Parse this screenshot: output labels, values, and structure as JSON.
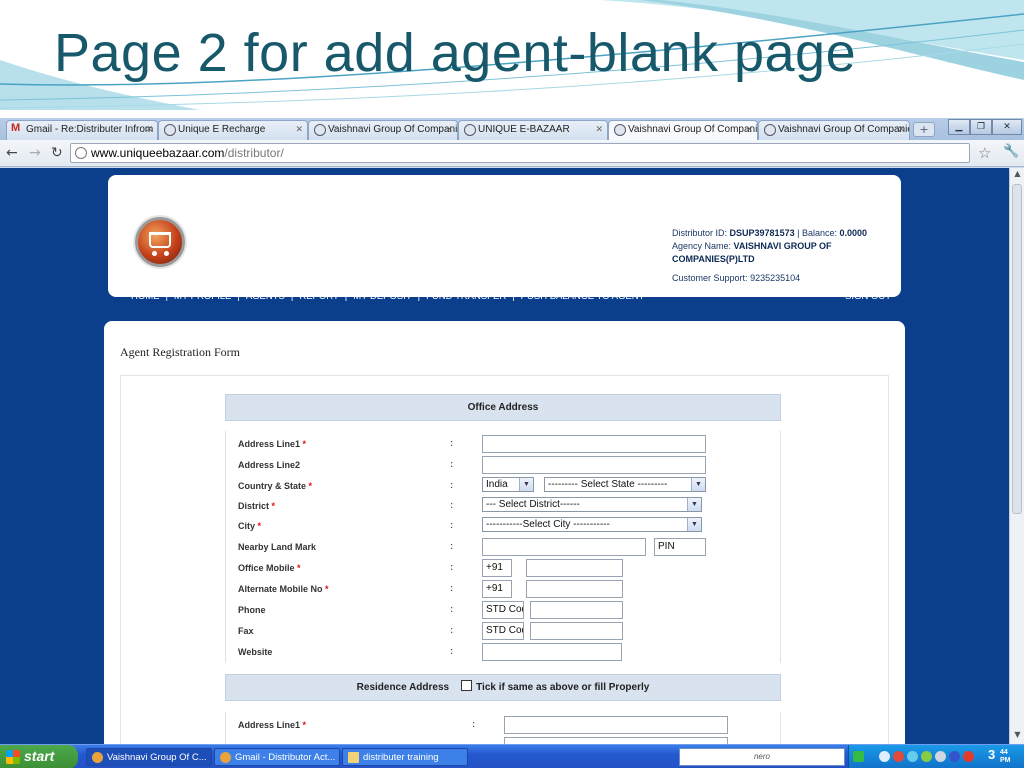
{
  "slide": {
    "title": "Page 2 for add agent-blank page"
  },
  "browser": {
    "tabs": [
      {
        "label": "Gmail - Re:Distributer Infrom"
      },
      {
        "label": "Unique E Recharge"
      },
      {
        "label": "Vaishnavi Group Of Companie"
      },
      {
        "label": "UNIQUE E-BAZAAR"
      },
      {
        "label": "Vaishnavi Group Of Companie"
      },
      {
        "label": "Vaishnavi Group Of Companie"
      }
    ],
    "address": {
      "host": "www.uniqueebazaar.com",
      "path": "/distributor/"
    }
  },
  "site": {
    "account": {
      "distributor_label": "Distributor ID:",
      "distributor_id": "DSUP39781573",
      "sep": "|",
      "balance_label": "Balance:",
      "balance": "0.0000",
      "agency_label": "Agency Name:",
      "agency_name": "VAISHNAVI GROUP OF COMPANIES(P)LTD",
      "support_label": "Customer Support:",
      "support_number": "9235235104"
    },
    "menu": {
      "items": [
        "HOME",
        "MY PROFILE",
        "AGENTS",
        "REPORT",
        "MY DEPOSIT",
        "FUND TRANSFER",
        "PUSH BALANCE TO AGENT"
      ],
      "separator": "|",
      "signout": "SIGN OUT"
    }
  },
  "form": {
    "title": "Agent Registration Form",
    "office_heading": "Office Address",
    "colon": ":",
    "required_mark": "*",
    "fields": {
      "address1": "Address Line1",
      "address2": "Address Line2",
      "country_state": "Country & State",
      "district": "District",
      "city": "City",
      "landmark": "Nearby Land Mark",
      "office_mobile": "Office Mobile",
      "alt_mobile": "Alternate Mobile No",
      "phone": "Phone",
      "fax": "Fax",
      "website": "Website"
    },
    "values": {
      "country": "India",
      "state": "--------- Select State ---------",
      "district": "--- Select District------",
      "city": "-----------Select City -----------",
      "pin_placeholder": "PIN",
      "mobile_prefix": "+91",
      "std_placeholder": "STD Code"
    },
    "residence": {
      "heading": "Residence Address",
      "checkbox_label": "Tick if same as above or fill Properly",
      "address1": "Address Line1"
    }
  },
  "taskbar": {
    "start": "start",
    "windows": [
      {
        "label": "Vaishnavi Group Of C..."
      },
      {
        "label": "Gmail - Distributor Act..."
      },
      {
        "label": "distributer training"
      }
    ],
    "search": "nero",
    "clock": {
      "time": "3",
      "minutes": "44",
      "ampm": "PM"
    }
  },
  "colors": {
    "title": "#17596b",
    "page_background": "#0b3f8c",
    "section_header": "#d8e3ef",
    "required": "#dd1111"
  }
}
